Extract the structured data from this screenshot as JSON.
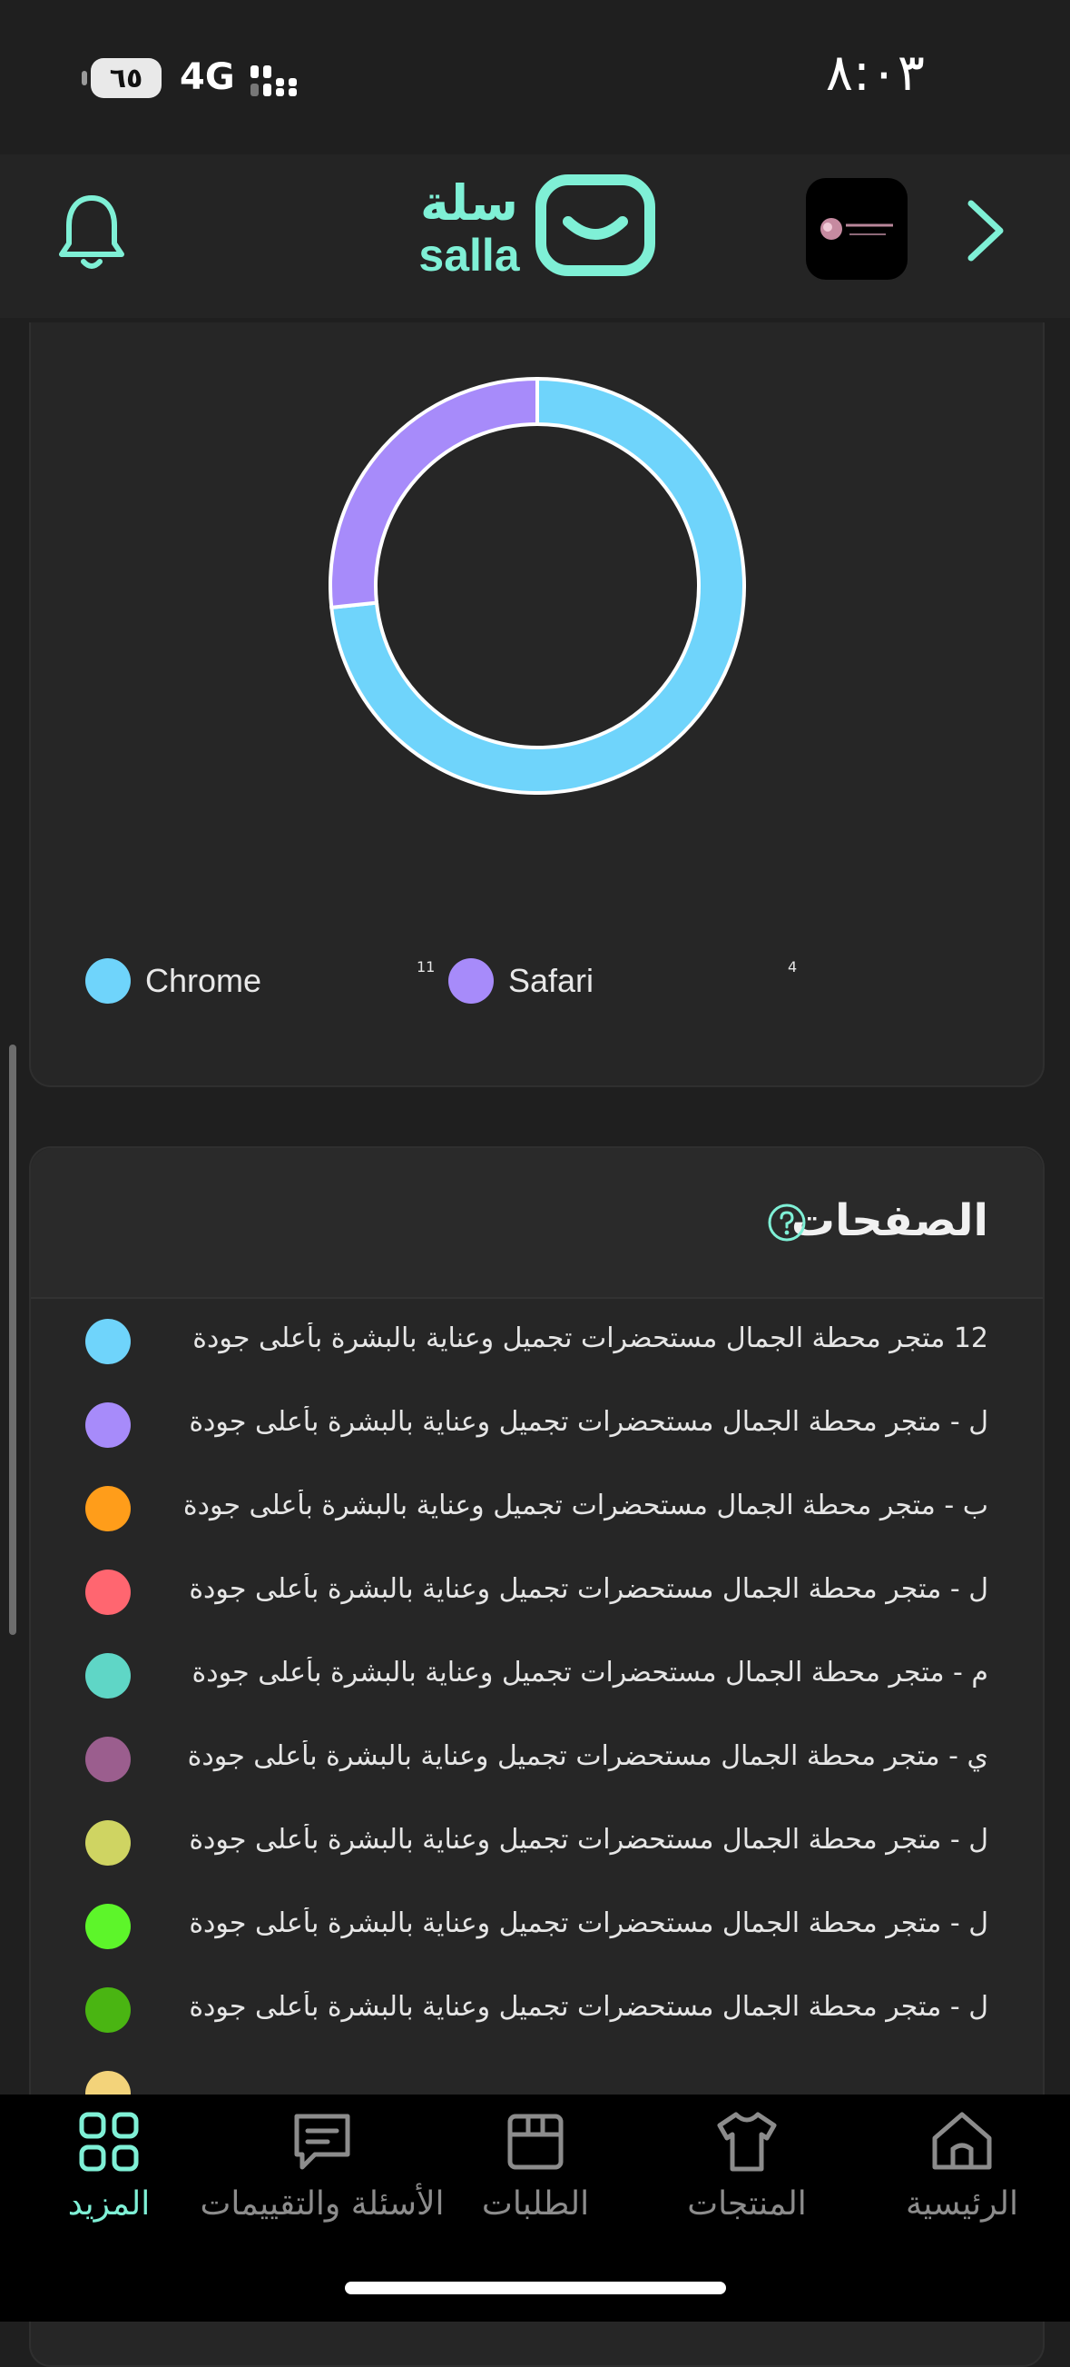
{
  "status_bar": {
    "time": "٨:٠٣",
    "battery": "٦٥",
    "network": "4G"
  },
  "header": {
    "logo_ar": "سلة",
    "logo_en": "salla"
  },
  "browsers_chart": {
    "chart_data": {
      "type": "pie",
      "categories": [
        "Chrome",
        "Safari"
      ],
      "values": [
        11,
        4
      ],
      "colors": [
        "#6fd4fb",
        "#a78bfa"
      ]
    },
    "legend": [
      {
        "label": "Chrome",
        "value": "11",
        "color": "#6fd4fb"
      },
      {
        "label": "Safari",
        "value": "4",
        "color": "#a78bfa"
      }
    ]
  },
  "pages_section": {
    "title": "الصفحات",
    "rows": [
      {
        "text": "12  متجر محطة الجمال مستحضرات تجميل وعناية بالبشرة بأعلى جودة",
        "color": "#6fd4fb"
      },
      {
        "text": "ل - متجر محطة الجمال مستحضرات تجميل وعناية بالبشرة بأعلى جودة",
        "color": "#a78bfa"
      },
      {
        "text": "ب - متجر محطة الجمال مستحضرات تجميل وعناية بالبشرة بأعلى جودة",
        "color": "#ff9d1a"
      },
      {
        "text": "ل - متجر محطة الجمال مستحضرات تجميل وعناية بالبشرة بأعلى جودة",
        "color": "#ff6670"
      },
      {
        "text": "م - متجر محطة الجمال مستحضرات تجميل وعناية بالبشرة بأعلى جودة",
        "color": "#5fd6c6"
      },
      {
        "text": "ي - متجر محطة الجمال مستحضرات تجميل وعناية بالبشرة بأعلى جودة",
        "color": "#9b5e8e"
      },
      {
        "text": "ل - متجر محطة الجمال مستحضرات تجميل وعناية بالبشرة بأعلى جودة",
        "color": "#cfd462"
      },
      {
        "text": "ل - متجر محطة الجمال مستحضرات تجميل وعناية بالبشرة بأعلى جودة",
        "color": "#5df52a"
      },
      {
        "text": "ل - متجر محطة الجمال مستحضرات تجميل وعناية بالبشرة بأعلى جودة",
        "color": "#4ab512"
      },
      {
        "text": "",
        "color": "#f3d37a"
      }
    ]
  },
  "tabbar": {
    "tabs": [
      {
        "label": "المزيد",
        "icon": "grid-icon",
        "active": true
      },
      {
        "label": "الأسئلة والتقييمات",
        "icon": "chat-icon",
        "active": false
      },
      {
        "label": "الطلبات",
        "icon": "box-icon",
        "active": false
      },
      {
        "label": "المنتجات",
        "icon": "shirt-icon",
        "active": false
      },
      {
        "label": "الرئيسية",
        "icon": "home-icon",
        "active": false
      }
    ]
  },
  "colors": {
    "accent": "#7ff0d6",
    "background": "#1f1f1f",
    "card": "#262626"
  }
}
